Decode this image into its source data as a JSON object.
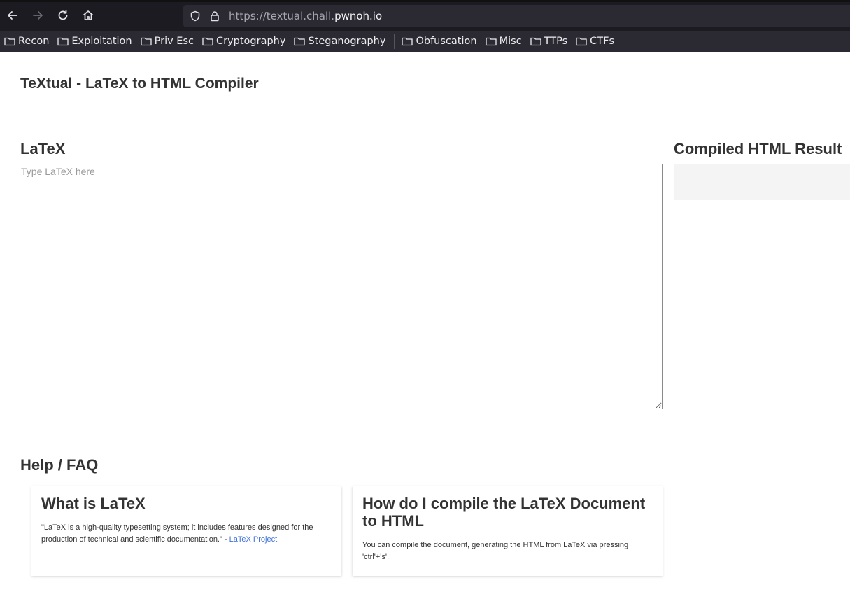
{
  "browser": {
    "url_prefix": "https://textual.chall.",
    "url_domain": "pwnoh.io",
    "bookmarks": [
      "Recon",
      "Exploitation",
      "Priv Esc",
      "Cryptography",
      "Steganography",
      "Obfuscation",
      "Misc",
      "TTPs",
      "CTFs"
    ]
  },
  "page": {
    "title": "TeXtual - LaTeX to HTML Compiler",
    "latex_heading": "LaTeX",
    "latex_placeholder": "Type LaTeX here",
    "latex_value": "",
    "result_heading": "Compiled HTML Result",
    "help_heading": "Help / FAQ"
  },
  "faq": [
    {
      "question": "What is LaTeX",
      "answer": "\"LaTeX is a high-quality typesetting system; it includes features designed for the production of technical and scientific documentation.\" - ",
      "link_text": "LaTeX Project"
    },
    {
      "question": "How do I compile the LaTeX Document to HTML",
      "answer": "You can compile the document, generating the HTML from LaTeX via pressing 'ctrl'+'s'."
    }
  ],
  "colors": {
    "chrome_bg": "#1c1b22",
    "toolbar_bg": "#2b2a33",
    "link": "#3f6fd8",
    "result_bg": "#f4f4f4"
  }
}
